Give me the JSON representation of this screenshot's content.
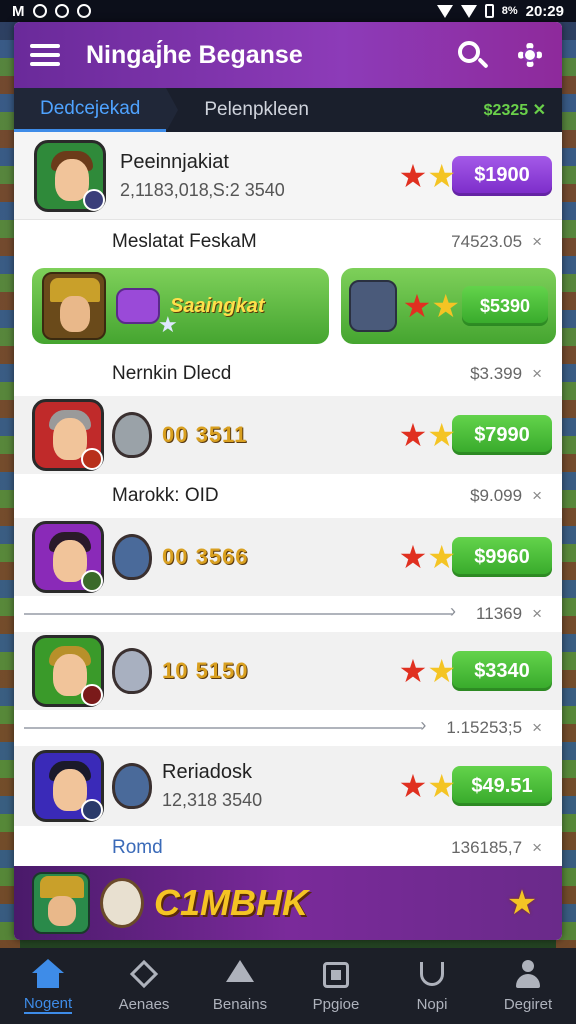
{
  "status_bar": {
    "left_text": "M",
    "time": "20:29",
    "battery": "8%"
  },
  "header": {
    "title": "Ningaj́he Beganse"
  },
  "tabs": [
    {
      "label": "Dedcejekad",
      "active": true
    },
    {
      "label": "Pelenpkleen",
      "active": false
    }
  ],
  "tabs_right": "$2325 ✕",
  "rows": {
    "r1": {
      "name": "Peeinnjakiat",
      "sub": "2,1183,018‚S:2 3540",
      "price": "$1900"
    },
    "s1": {
      "title": "Meslatat FeskaM",
      "meta": "74523.05",
      "x": "×"
    },
    "featured": {
      "text": "Saaingkat",
      "price": "$5390"
    },
    "s2": {
      "title": "Nernkin Dlecd",
      "meta": "$3.399",
      "x": "×"
    },
    "r2": {
      "code": "00 3511",
      "price": "$7990"
    },
    "s3": {
      "title": "Marokk: OID",
      "meta": "$9.099",
      "x": "×"
    },
    "r3": {
      "code": "00 3566",
      "price": "$9960"
    },
    "d1": {
      "meta": "11369",
      "x": "×"
    },
    "r4": {
      "code": "10 5150",
      "price": "$3340"
    },
    "d2": {
      "meta": "1.15253;5",
      "x": "×"
    },
    "r5": {
      "name": "Reriadosk",
      "sub": "12,318 3540",
      "price": "$49.51"
    },
    "foot": {
      "link": "Romd",
      "meta": "136185,7",
      "x": "×"
    }
  },
  "promo": {
    "text": "C1MBHK"
  },
  "bottom_nav": [
    {
      "label": "Nogent",
      "icon": "home-icon",
      "active": true
    },
    {
      "label": "Aenaes",
      "icon": "diamond-icon",
      "active": false
    },
    {
      "label": "Benains",
      "icon": "triangle-icon",
      "active": false
    },
    {
      "label": "Ppgioe",
      "icon": "square-icon",
      "active": false
    },
    {
      "label": "Nopi",
      "icon": "trophy-icon",
      "active": false
    },
    {
      "label": "Degiret",
      "icon": "person-icon",
      "active": false
    }
  ],
  "colors": {
    "accent": "#3e8ce8",
    "header": "#8d3bb8",
    "price_green": "#36a82a",
    "price_purple": "#7a2ac8"
  }
}
